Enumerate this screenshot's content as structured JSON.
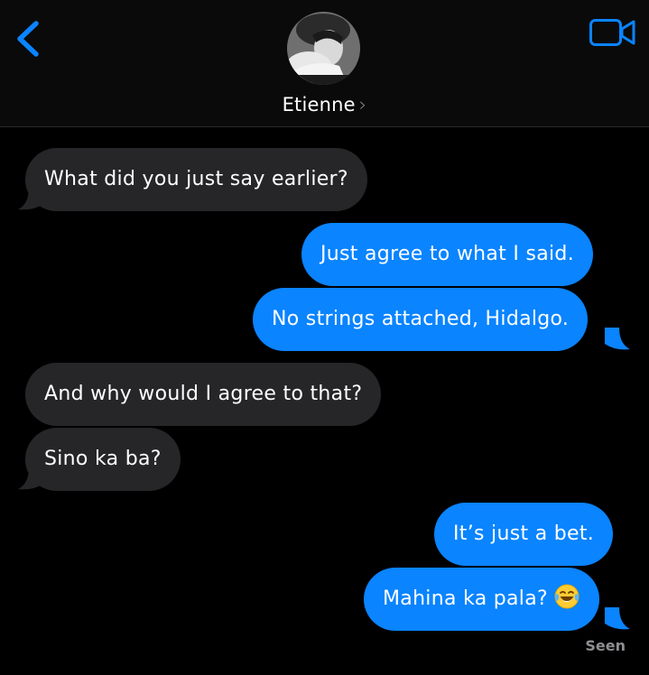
{
  "header": {
    "contact_name": "Etienne",
    "chevron": "›",
    "back_icon": "chevron-left-icon",
    "video_icon": "video-camera-icon",
    "accent": "#0a84ff"
  },
  "messages": [
    {
      "direction": "incoming",
      "text": "What did you just say earlier?"
    },
    {
      "direction": "outgoing",
      "text": "Just agree to what I said."
    },
    {
      "direction": "outgoing",
      "text": "No strings attached, Hidalgo."
    },
    {
      "direction": "incoming",
      "text": "And why would I agree to that?"
    },
    {
      "direction": "incoming",
      "text": "Sino ka ba?"
    },
    {
      "direction": "outgoing",
      "text": "It’s just a bet."
    },
    {
      "direction": "outgoing",
      "text": "Mahina ka pala?",
      "emoji": "tears-of-joy-emoji"
    }
  ],
  "status": {
    "seen_label": "Seen"
  },
  "colors": {
    "incoming_bubble": "#262628",
    "outgoing_bubble": "#0a84ff",
    "background": "#000000"
  }
}
